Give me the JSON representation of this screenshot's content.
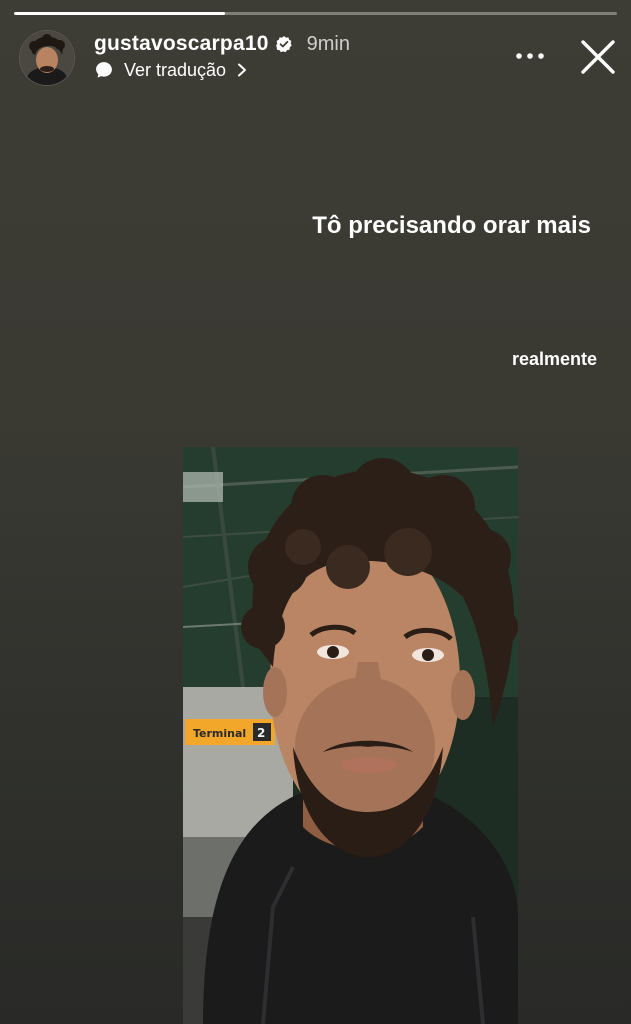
{
  "story": {
    "progress_fraction": 0.35,
    "username": "gustavoscarpa10",
    "timestamp": "9min",
    "translate_label": "Ver tradução",
    "caption_main": "Tô precisando orar mais",
    "caption_secondary": "realmente",
    "photo_sign_text": "Terminal",
    "photo_sign_number": "2"
  },
  "icons": {
    "verified": "verified-badge-icon",
    "translate": "translate-icon",
    "chevron": "chevron-right-icon",
    "more": "more-options-icon",
    "close": "close-icon"
  },
  "colors": {
    "background_top": "#3d3c35",
    "background_bottom": "#292a27",
    "text": "#ffffff",
    "sign_yellow": "#f2a72b"
  }
}
